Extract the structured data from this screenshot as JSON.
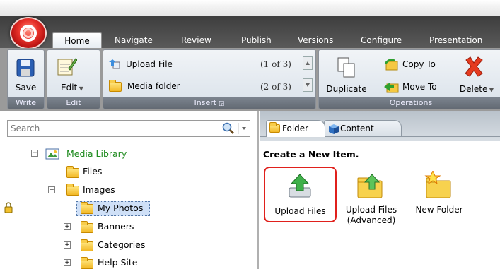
{
  "tabs": [
    "Home",
    "Navigate",
    "Review",
    "Publish",
    "Versions",
    "Configure",
    "Presentation"
  ],
  "ribbon": {
    "write": {
      "save_label": "Save",
      "group": "Write"
    },
    "edit": {
      "edit_label": "Edit",
      "group": "Edit"
    },
    "insert": {
      "upload_file": "Upload File",
      "upload_count": "(1 of 3)",
      "media_folder": "Media folder",
      "media_count": "(2 of 3)",
      "group": "Insert"
    },
    "operations": {
      "duplicate": "Duplicate",
      "copy_to": "Copy To",
      "move_to": "Move To",
      "delete": "Delete",
      "group": "Operations"
    }
  },
  "search": {
    "placeholder": "Search"
  },
  "tree": {
    "root": "Media Library",
    "items": [
      "Files",
      "Images",
      "My Photos",
      "Banners",
      "Categories",
      "Help Site"
    ]
  },
  "right_tabs": [
    "Folder",
    "Content"
  ],
  "create": {
    "header": "Create a New Item.",
    "items": [
      {
        "label": "Upload Files"
      },
      {
        "label1": "Upload Files",
        "label2": "(Advanced)"
      },
      {
        "label": "New Folder"
      }
    ]
  },
  "colors": {
    "highlight_red": "#e0201c",
    "selected_bg": "#cfe0f7",
    "root_green": "#1d8a1d"
  }
}
